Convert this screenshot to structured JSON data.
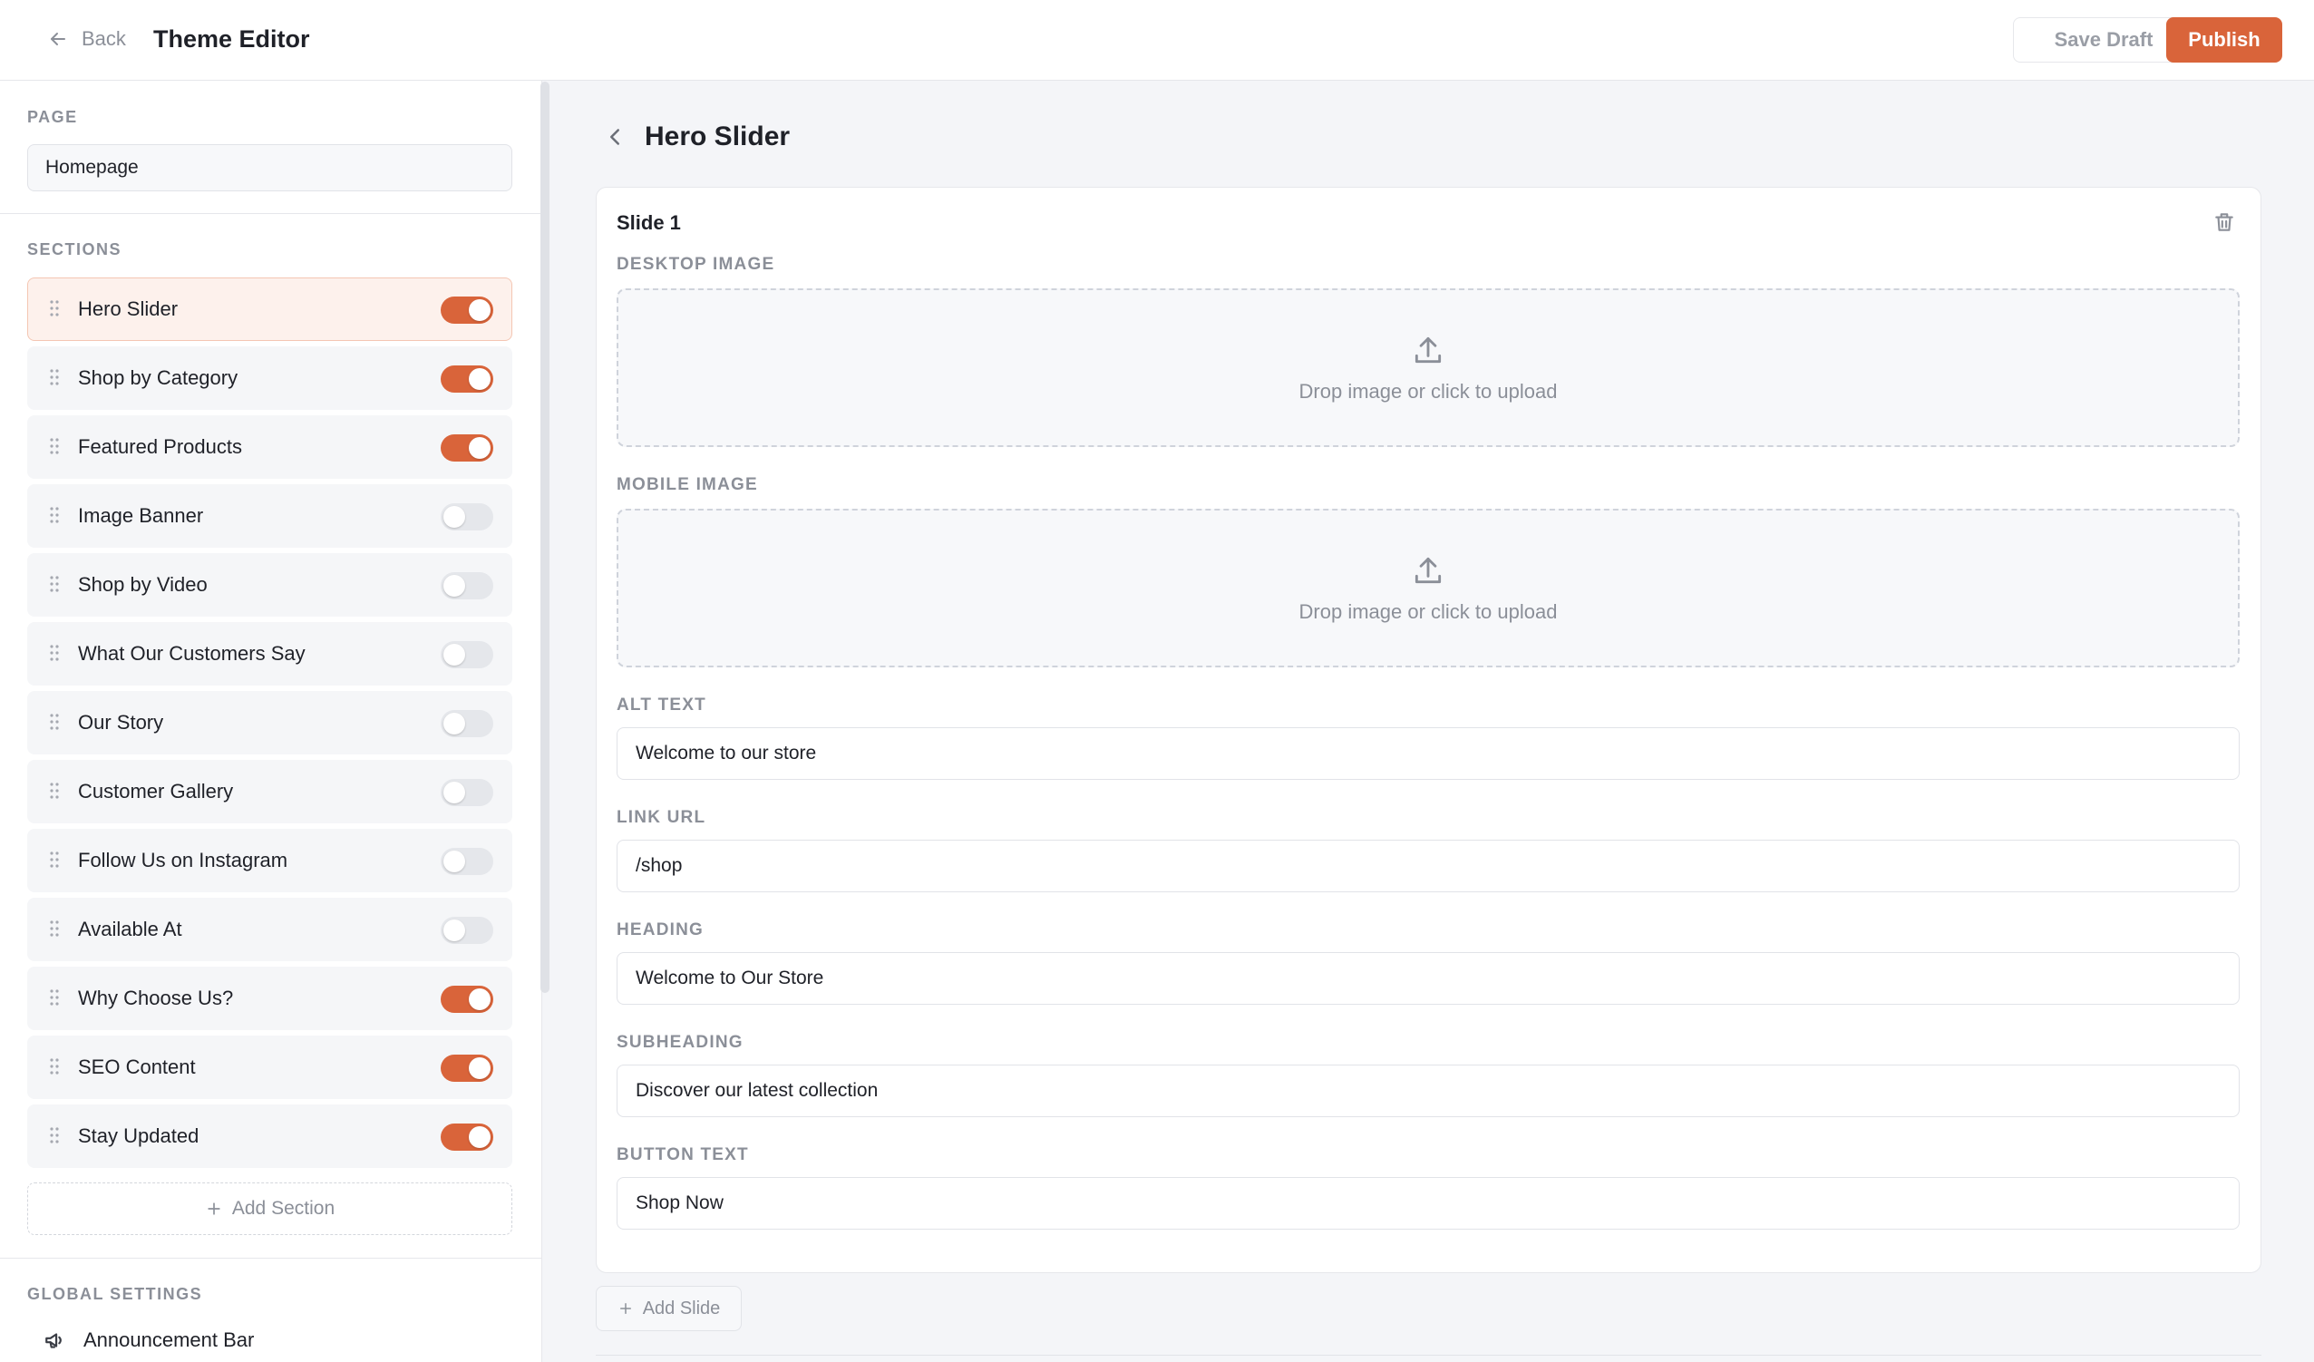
{
  "header": {
    "back_label": "Back",
    "title": "Theme Editor",
    "save_draft_label": "Save Draft",
    "publish_label": "Publish"
  },
  "sidebar": {
    "page_label": "PAGE",
    "page_value": "Homepage",
    "sections_label": "SECTIONS",
    "sections": [
      {
        "label": "Hero Slider",
        "enabled": true,
        "active": true
      },
      {
        "label": "Shop by Category",
        "enabled": true,
        "active": false
      },
      {
        "label": "Featured Products",
        "enabled": true,
        "active": false
      },
      {
        "label": "Image Banner",
        "enabled": false,
        "active": false
      },
      {
        "label": "Shop by Video",
        "enabled": false,
        "active": false
      },
      {
        "label": "What Our Customers Say",
        "enabled": false,
        "active": false
      },
      {
        "label": "Our Story",
        "enabled": false,
        "active": false
      },
      {
        "label": "Customer Gallery",
        "enabled": false,
        "active": false
      },
      {
        "label": "Follow Us on Instagram",
        "enabled": false,
        "active": false
      },
      {
        "label": "Available At",
        "enabled": false,
        "active": false
      },
      {
        "label": "Why Choose Us?",
        "enabled": true,
        "active": false
      },
      {
        "label": "SEO Content",
        "enabled": true,
        "active": false
      },
      {
        "label": "Stay Updated",
        "enabled": true,
        "active": false
      }
    ],
    "add_section_label": "Add Section",
    "global_settings_label": "GLOBAL SETTINGS",
    "global_settings": [
      {
        "label": "Announcement Bar",
        "icon": "megaphone-icon"
      }
    ]
  },
  "panel": {
    "title": "Hero Slider",
    "slide": {
      "title": "Slide 1",
      "desktop_image_label": "DESKTOP IMAGE",
      "mobile_image_label": "MOBILE IMAGE",
      "upload_prompt": "Drop image or click to upload",
      "alt_text_label": "ALT TEXT",
      "alt_text_value": "Welcome to our store",
      "link_url_label": "LINK URL",
      "link_url_value": "/shop",
      "heading_label": "HEADING",
      "heading_value": "Welcome to Our Store",
      "subheading_label": "SUBHEADING",
      "subheading_value": "Discover our latest collection",
      "button_text_label": "BUTTON TEXT",
      "button_text_value": "Shop Now"
    },
    "add_slide_label": "Add Slide"
  },
  "colors": {
    "accent": "#d9643a",
    "active_bg": "#fdf1ec"
  }
}
